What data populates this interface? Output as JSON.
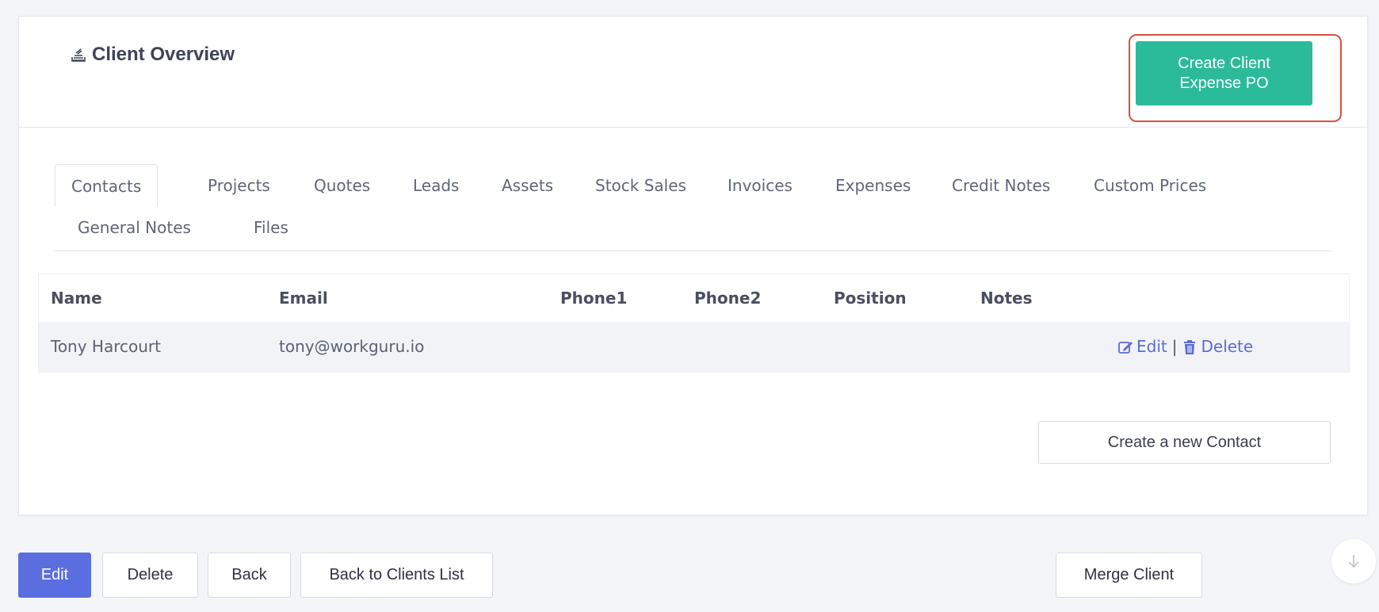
{
  "card": {
    "title": "Client Overview",
    "title_icon": "stack-icon",
    "create_po_label": "Create Client\nExpense PO"
  },
  "tabs": [
    {
      "label": "Contacts",
      "active": true
    },
    {
      "label": "Projects"
    },
    {
      "label": "Quotes"
    },
    {
      "label": "Leads"
    },
    {
      "label": "Assets"
    },
    {
      "label": "Stock Sales"
    },
    {
      "label": "Invoices"
    },
    {
      "label": "Expenses"
    },
    {
      "label": "Credit Notes"
    },
    {
      "label": "Custom Prices"
    },
    {
      "label": "General Notes"
    },
    {
      "label": "Files"
    }
  ],
  "table": {
    "headers": [
      "Name",
      "Email",
      "Phone1",
      "Phone2",
      "Position",
      "Notes"
    ],
    "rows": [
      {
        "name": "Tony Harcourt",
        "email": "tony@workguru.io",
        "phone1": "",
        "phone2": "",
        "position": "",
        "notes": "",
        "edit_label": "Edit",
        "separator": "|",
        "delete_label": "Delete"
      }
    ]
  },
  "create_contact_label": "Create a new Contact",
  "bottom_buttons": {
    "edit": "Edit",
    "delete": "Delete",
    "back": "Back",
    "back_to_list": "Back to Clients List",
    "merge": "Merge Client"
  },
  "colors": {
    "accent_teal": "#2bbb9b",
    "primary_blue": "#5a6ee0",
    "link_blue": "#5a6bd8",
    "highlight_red": "#d9503f"
  }
}
